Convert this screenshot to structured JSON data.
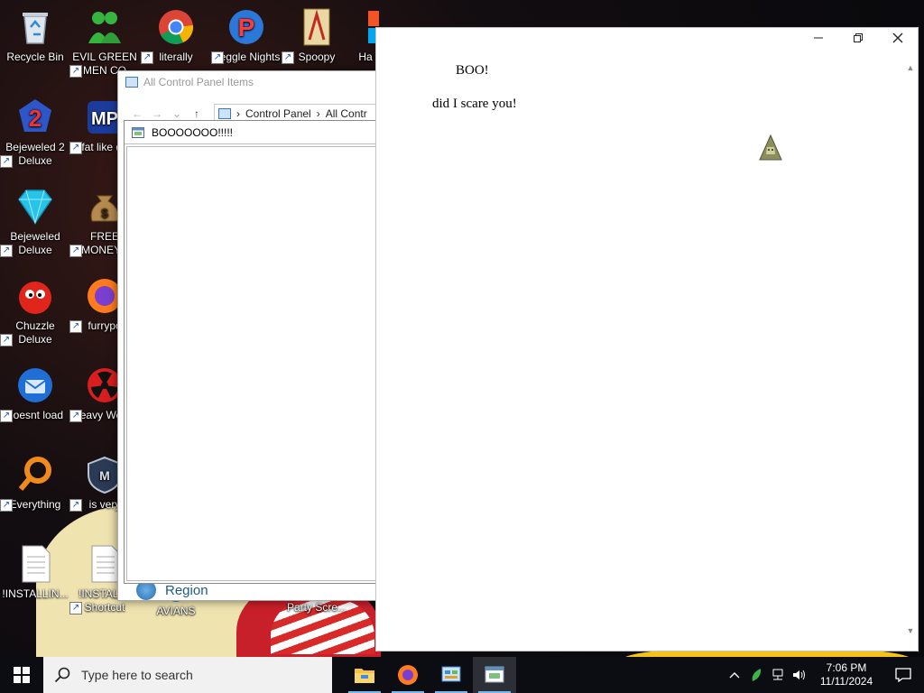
{
  "desktop": {
    "icons": [
      {
        "label": "Recycle Bin",
        "icon": "recycle-bin-icon",
        "shortcut": false
      },
      {
        "label": "EVIL GREEN MEN CO",
        "icon": "green-people-icon",
        "shortcut": true
      },
      {
        "label": "literally",
        "icon": "chrome-icon",
        "shortcut": true
      },
      {
        "label": "Peggle Nights",
        "icon": "peggle-icon",
        "shortcut": true
      },
      {
        "label": "Spoopy",
        "icon": "spoopy-icon",
        "shortcut": true
      },
      {
        "label": "Ha",
        "icon": "windows-logo-icon",
        "shortcut": true
      },
      {
        "label": "Bejeweled 2 Deluxe",
        "icon": "bejeweled-2-icon",
        "shortcut": true
      },
      {
        "label": "fat like da",
        "icon": "mp-logo-icon",
        "shortcut": true
      },
      {
        "label": "Bejeweled Deluxe",
        "icon": "diamond-icon",
        "shortcut": true
      },
      {
        "label": "FREE MONEY.c",
        "icon": "money-bag-icon",
        "shortcut": true
      },
      {
        "label": "Chuzzle Deluxe",
        "icon": "chuzzle-icon",
        "shortcut": true
      },
      {
        "label": "furrypo",
        "icon": "firefox-icon",
        "shortcut": true
      },
      {
        "label": "doesnt load",
        "icon": "thunderbird-icon",
        "shortcut": true
      },
      {
        "label": "Heavy Weap.",
        "icon": "radiation-icon",
        "shortcut": true
      },
      {
        "label": "Everything",
        "icon": "everything-search-icon",
        "shortcut": true
      },
      {
        "label": "is very",
        "icon": "shield-logo-icon",
        "shortcut": true
      },
      {
        "label": "!INSTALLIN...",
        "icon": "text-file-icon",
        "shortcut": false
      },
      {
        "label": "!INSTALL - Shortcut",
        "icon": "text-file-icon",
        "shortcut": true
      },
      {
        "label": "AVIANS",
        "icon": "globe-icon",
        "shortcut": false
      },
      {
        "label": "Party Scre...",
        "icon": "party-icon",
        "shortcut": false
      }
    ]
  },
  "control_panel": {
    "title": "All Control Panel Items",
    "breadcrumb": [
      "Control Panel",
      "All Contr"
    ],
    "visible_item": "Region"
  },
  "boo_dialog": {
    "title": "BOOOOOOO!!!!!"
  },
  "main_window": {
    "heading": "BOO!",
    "message": "did I scare you!"
  },
  "taskbar": {
    "search_placeholder": "Type here to search",
    "apps": [
      "file-explorer-icon",
      "firefox-icon",
      "control-panel-icon",
      "dialog-app-icon"
    ],
    "time": "7:06 PM",
    "date": "11/11/2024"
  },
  "colors": {
    "taskbar_bg": "#0b0d12",
    "accent": "#76b9ed",
    "control_panel_link": "#1f5a8a"
  }
}
